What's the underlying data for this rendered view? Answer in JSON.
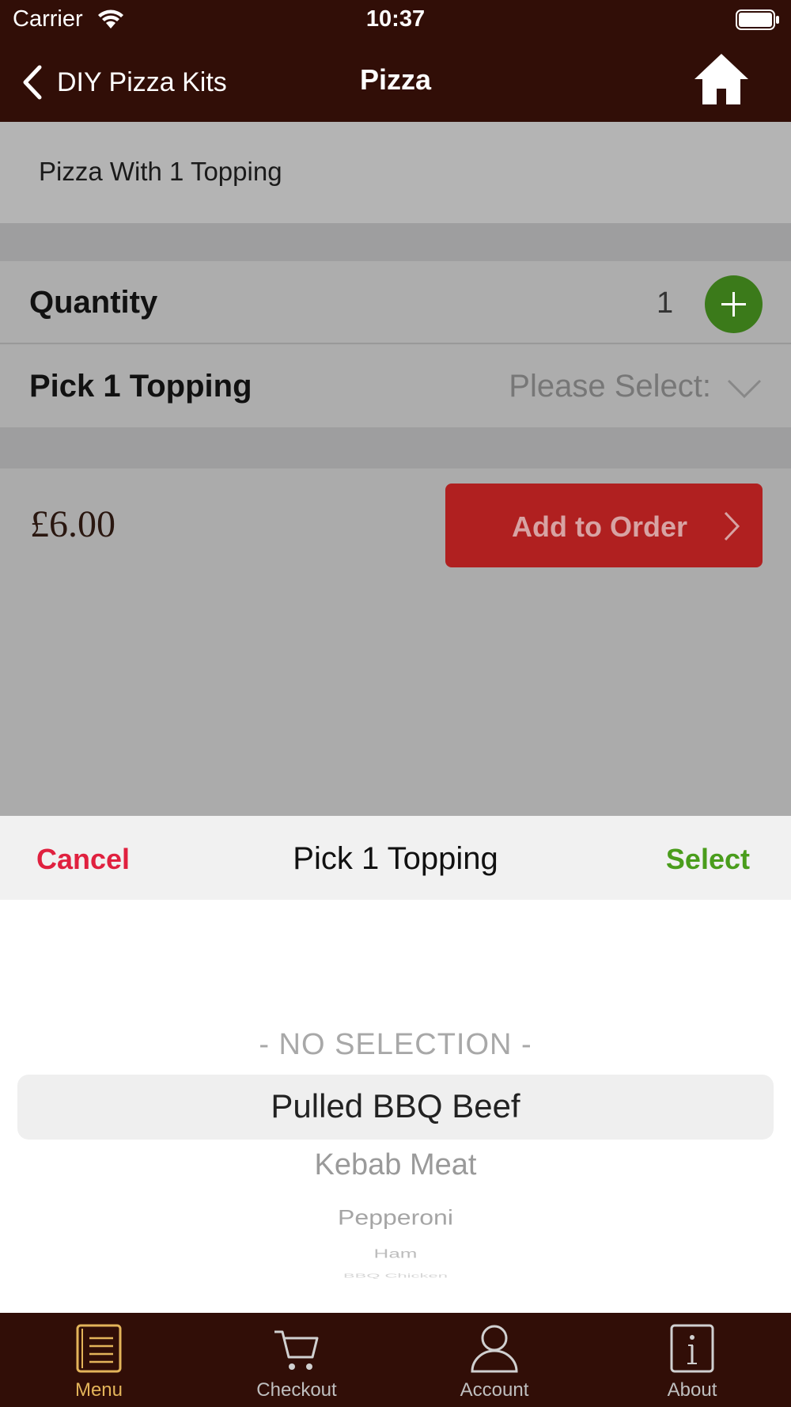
{
  "status_bar": {
    "carrier": "Carrier",
    "time": "10:37"
  },
  "nav": {
    "back_label": "DIY Pizza Kits",
    "title": "Pizza"
  },
  "item": {
    "description": "Pizza With 1 Topping"
  },
  "quantity": {
    "label": "Quantity",
    "value": "1"
  },
  "topping": {
    "label": "Pick 1 Topping",
    "placeholder": "Please Select:"
  },
  "order": {
    "price": "£6.00",
    "add_label": "Add to Order"
  },
  "sheet": {
    "cancel_label": "Cancel",
    "title": "Pick 1 Topping",
    "select_label": "Select"
  },
  "picker": {
    "options": [
      "- NO SELECTION -",
      "Pulled BBQ Beef",
      "Kebab Meat",
      "Pepperoni",
      "Ham",
      "BBQ Chicken"
    ],
    "selected": "Pulled BBQ Beef"
  },
  "tabs": [
    {
      "label": "Menu",
      "icon": "menu-icon",
      "active": true
    },
    {
      "label": "Checkout",
      "icon": "cart-icon",
      "active": false
    },
    {
      "label": "Account",
      "icon": "user-icon",
      "active": false
    },
    {
      "label": "About",
      "icon": "info-icon",
      "active": false
    }
  ],
  "colors": {
    "header_bg": "#310e07",
    "add_button": "#b02020",
    "plus_button": "#3b7a1a",
    "cancel": "#e0213f",
    "select": "#4a9d1c",
    "tab_active": "#e3b45a"
  }
}
